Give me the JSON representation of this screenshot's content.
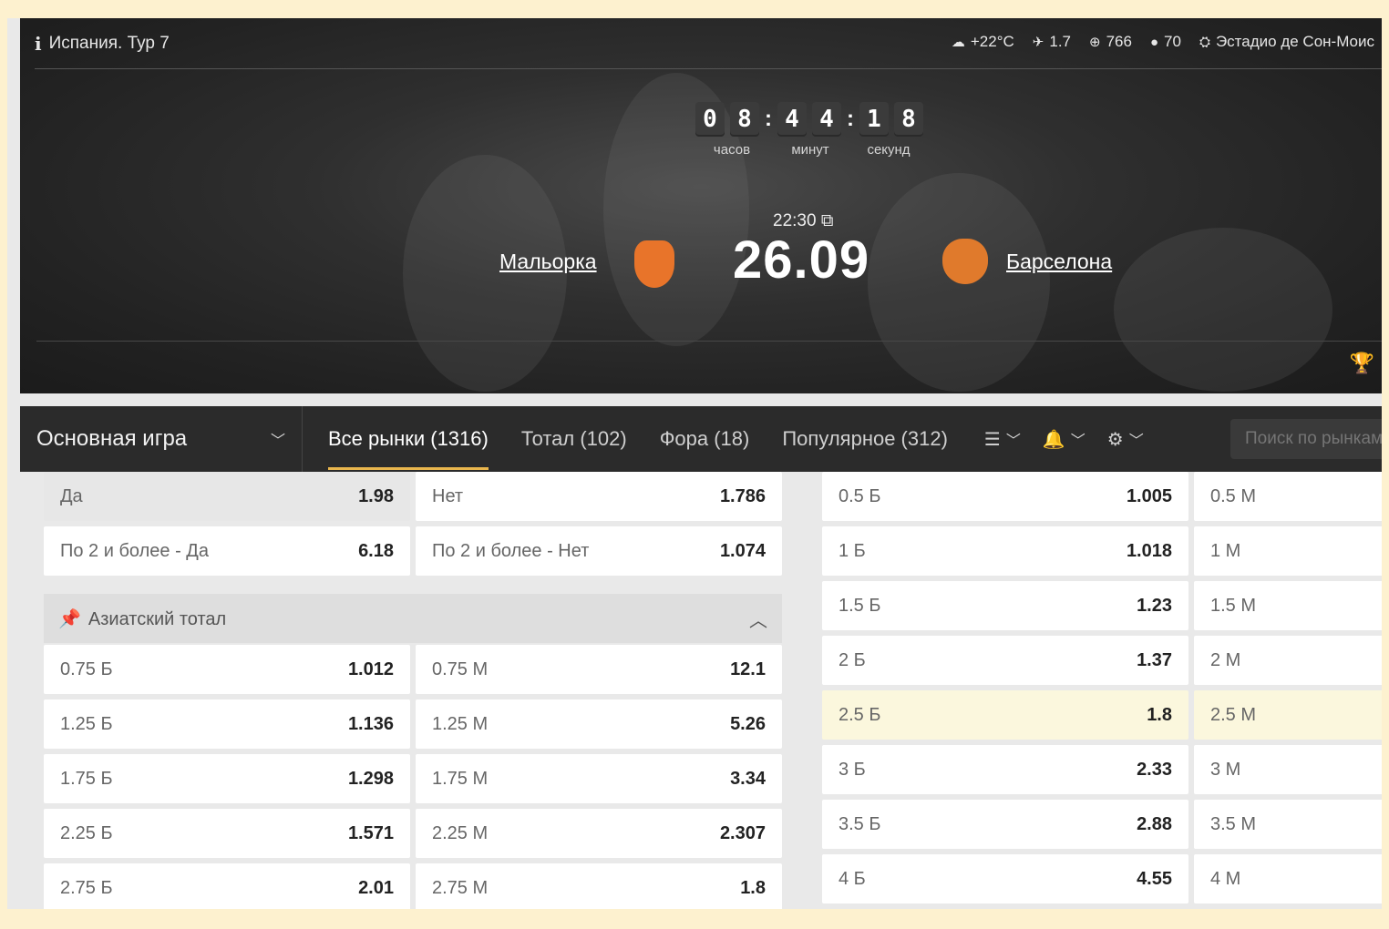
{
  "header": {
    "league": "Испания. Тур 7",
    "weather": [
      {
        "icon": "cloud-icon",
        "text": "+22°C"
      },
      {
        "icon": "wind-icon",
        "text": "1.7"
      },
      {
        "icon": "pressure-icon",
        "text": "766"
      },
      {
        "icon": "humidity-icon",
        "text": "70"
      }
    ],
    "stadium": "Эстадио де Сон-Моис",
    "countdown": {
      "digits": [
        "0",
        "8",
        "4",
        "4",
        "1",
        "8"
      ],
      "labels": [
        "часов",
        "минут",
        "секунд"
      ]
    },
    "time": "22:30",
    "date": "26.09",
    "home_team": "Мальорка",
    "away_team": "Барселона"
  },
  "tabbar": {
    "main_select": "Основная игра",
    "tabs": [
      {
        "label": "Все рынки (1316)"
      },
      {
        "label": "Тотал (102)"
      },
      {
        "label": "Фора (18)"
      },
      {
        "label": "Популярное (312)"
      }
    ],
    "search_placeholder": "Поиск по рынкам"
  },
  "left_top_rows": [
    {
      "a_label": "Да",
      "a_odd": "1.98",
      "b_label": "Нет",
      "b_odd": "1.786"
    },
    {
      "a_label": "По 2 и более - Да",
      "a_odd": "6.18",
      "b_label": "По 2 и более - Нет",
      "b_odd": "1.074"
    }
  ],
  "asian_total": {
    "title": "Азиатский тотал",
    "rows": [
      {
        "a_label": "0.75 Б",
        "a_odd": "1.012",
        "b_label": "0.75 М",
        "b_odd": "12.1"
      },
      {
        "a_label": "1.25 Б",
        "a_odd": "1.136",
        "b_label": "1.25 М",
        "b_odd": "5.26"
      },
      {
        "a_label": "1.75 Б",
        "a_odd": "1.298",
        "b_label": "1.75 М",
        "b_odd": "3.34"
      },
      {
        "a_label": "2.25 Б",
        "a_odd": "1.571",
        "b_label": "2.25 М",
        "b_odd": "2.307"
      },
      {
        "a_label": "2.75 Б",
        "a_odd": "2.01",
        "b_label": "2.75 М",
        "b_odd": "1.8"
      }
    ]
  },
  "right_rows": [
    {
      "a_label": "0.5 Б",
      "a_odd": "1.005",
      "b_label": "0.5 М"
    },
    {
      "a_label": "1 Б",
      "a_odd": "1.018",
      "b_label": "1 М"
    },
    {
      "a_label": "1.5 Б",
      "a_odd": "1.23",
      "b_label": "1.5 М"
    },
    {
      "a_label": "2 Б",
      "a_odd": "1.37",
      "b_label": "2 М"
    },
    {
      "a_label": "2.5 Б",
      "a_odd": "1.8",
      "b_label": "2.5 М"
    },
    {
      "a_label": "3 Б",
      "a_odd": "2.33",
      "b_label": "3 М"
    },
    {
      "a_label": "3.5 Б",
      "a_odd": "2.88",
      "b_label": "3.5 М"
    },
    {
      "a_label": "4 Б",
      "a_odd": "4.55",
      "b_label": "4 М"
    }
  ]
}
